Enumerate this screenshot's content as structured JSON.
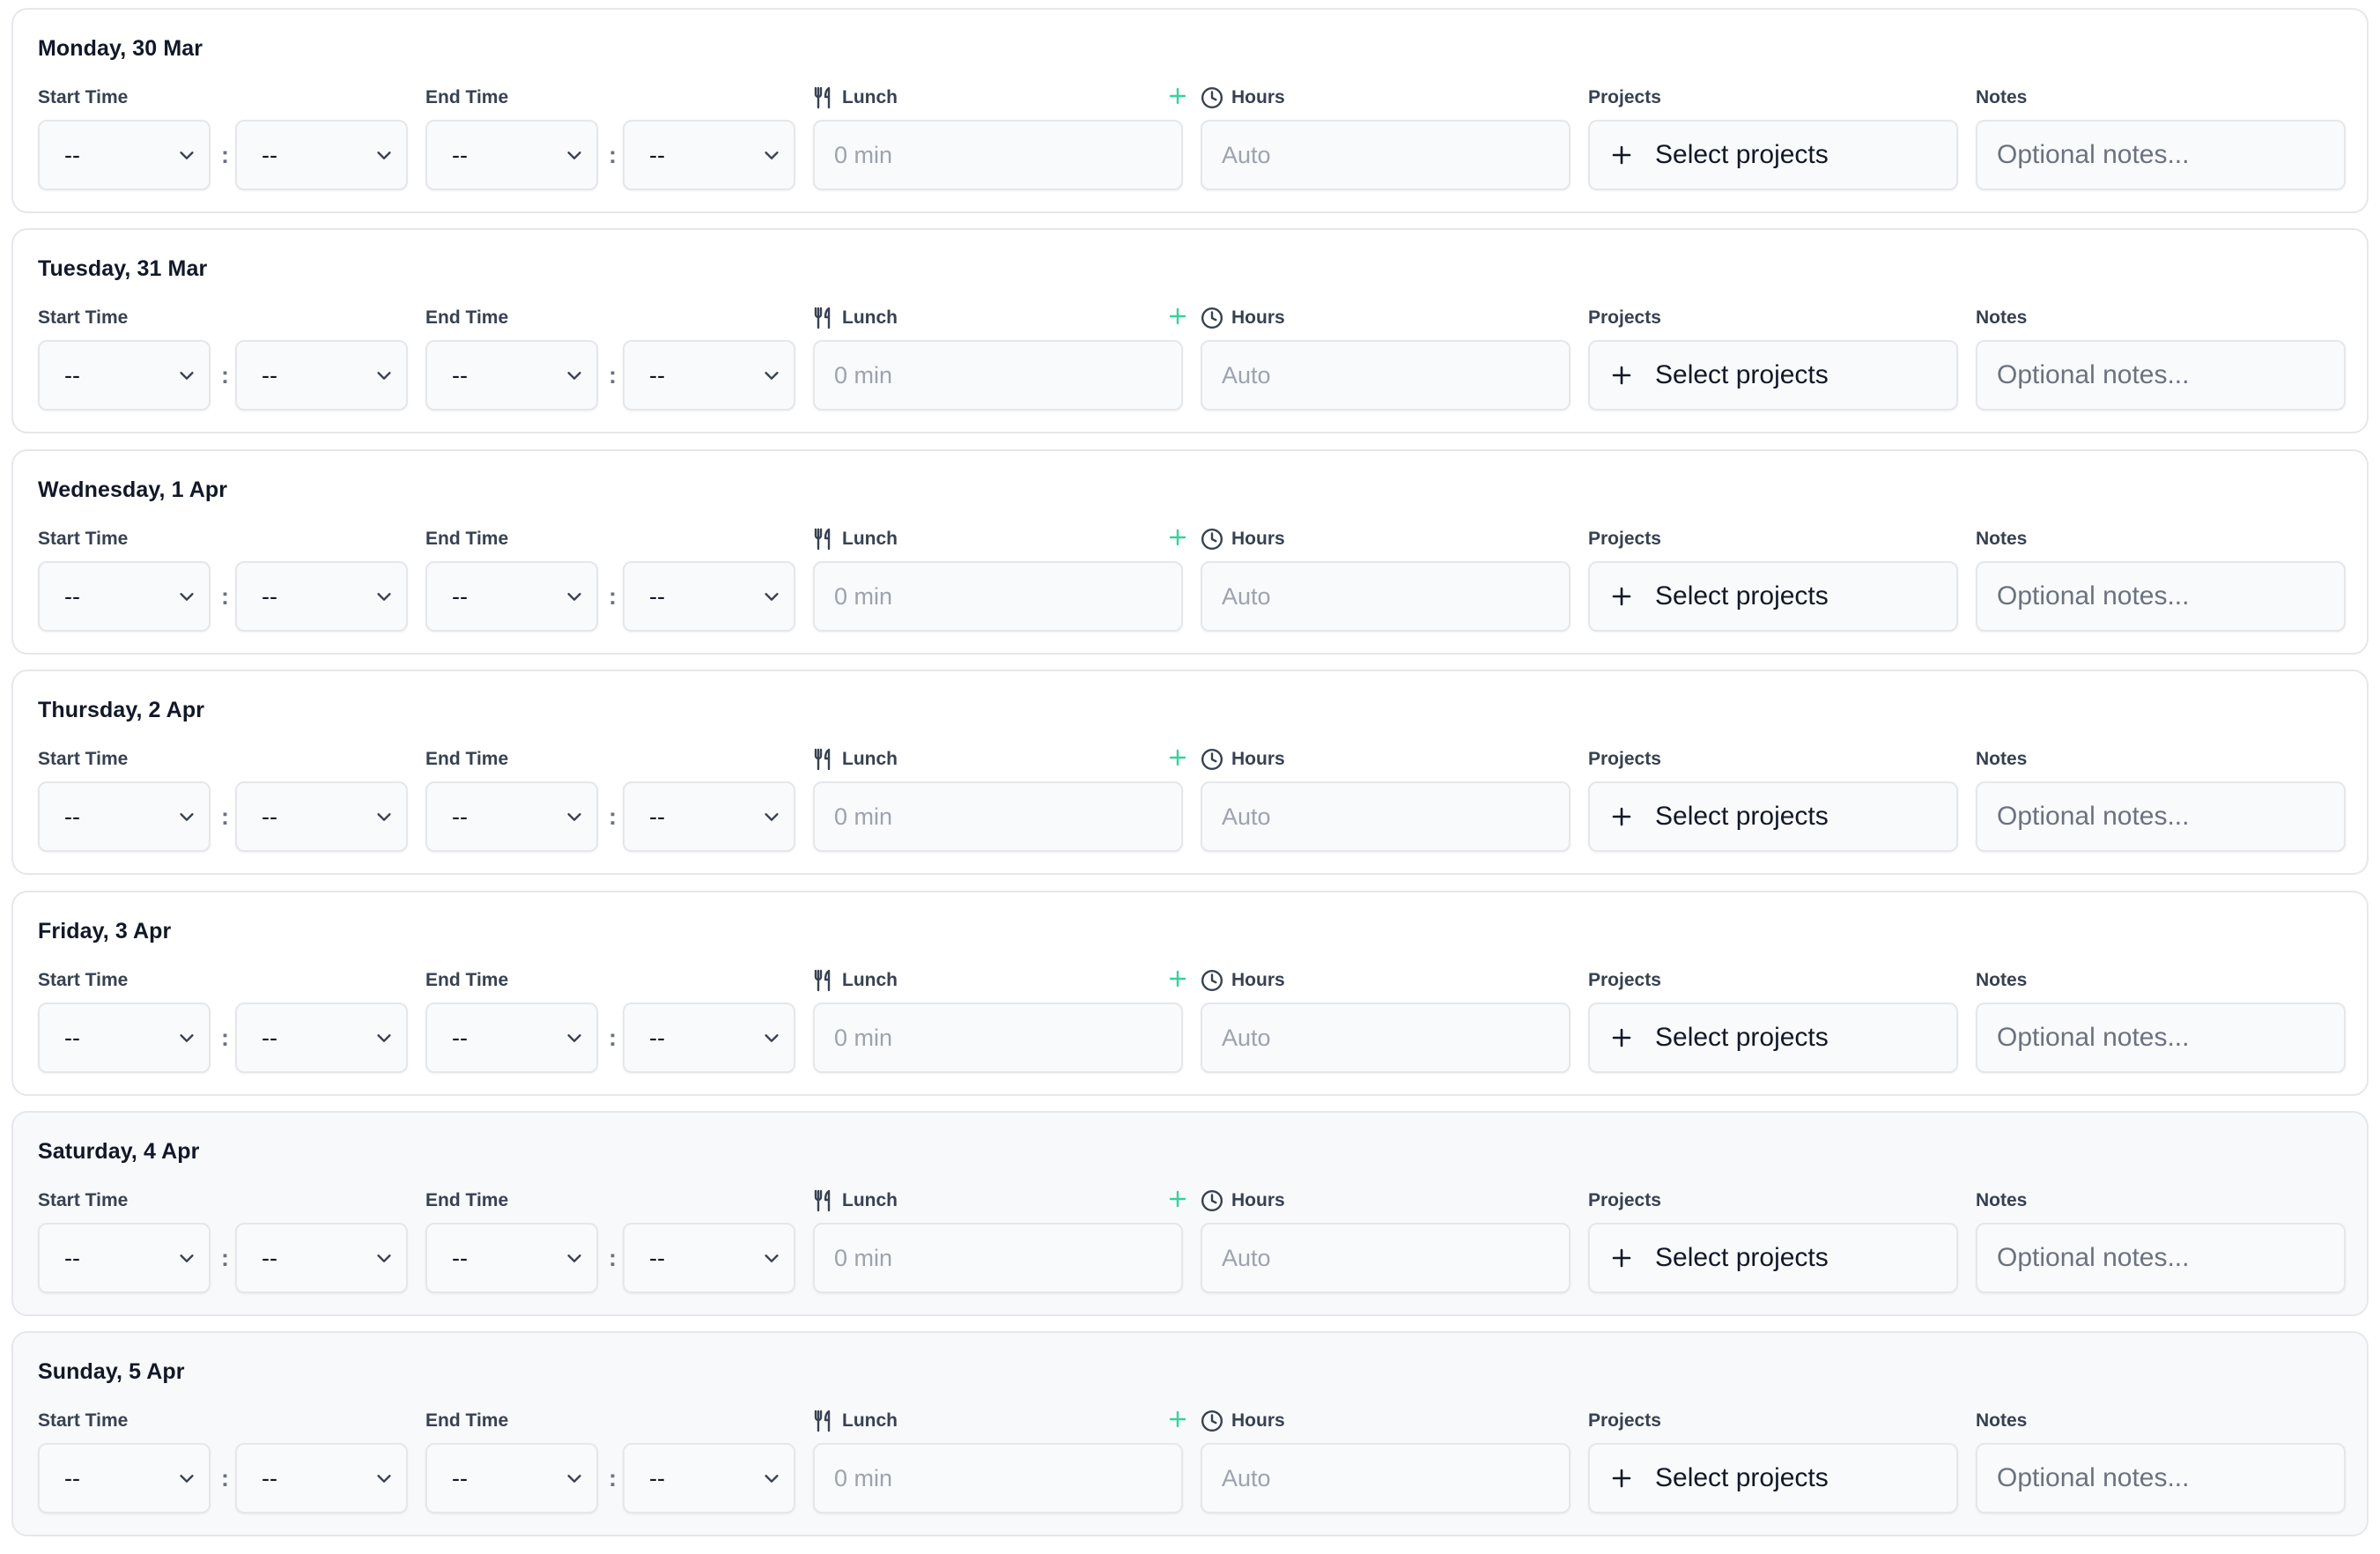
{
  "labels": {
    "start_time": "Start Time",
    "end_time": "End Time",
    "lunch": "Lunch",
    "hours": "Hours",
    "projects": "Projects",
    "notes": "Notes"
  },
  "select_placeholder": "--",
  "time_separator": ":",
  "lunch_placeholder": "0 min",
  "hours_placeholder": "Auto",
  "projects_button_label": "Select projects",
  "notes_placeholder": "Optional notes...",
  "icons": {
    "lunch": "fork-knife-icon",
    "lunch_add": "plus-icon",
    "hours": "clock-icon",
    "projects_add": "plus-icon",
    "select_caret": "chevron-down-icon"
  },
  "colors": {
    "accent_green": "#34d399",
    "weekend_background": "#f8f9fb"
  },
  "days": [
    {
      "title": "Monday, 30 Mar",
      "weekend": false
    },
    {
      "title": "Tuesday, 31 Mar",
      "weekend": false
    },
    {
      "title": "Wednesday, 1 Apr",
      "weekend": false
    },
    {
      "title": "Thursday, 2 Apr",
      "weekend": false
    },
    {
      "title": "Friday, 3 Apr",
      "weekend": false
    },
    {
      "title": "Saturday, 4 Apr",
      "weekend": true
    },
    {
      "title": "Sunday, 5 Apr",
      "weekend": true
    }
  ]
}
